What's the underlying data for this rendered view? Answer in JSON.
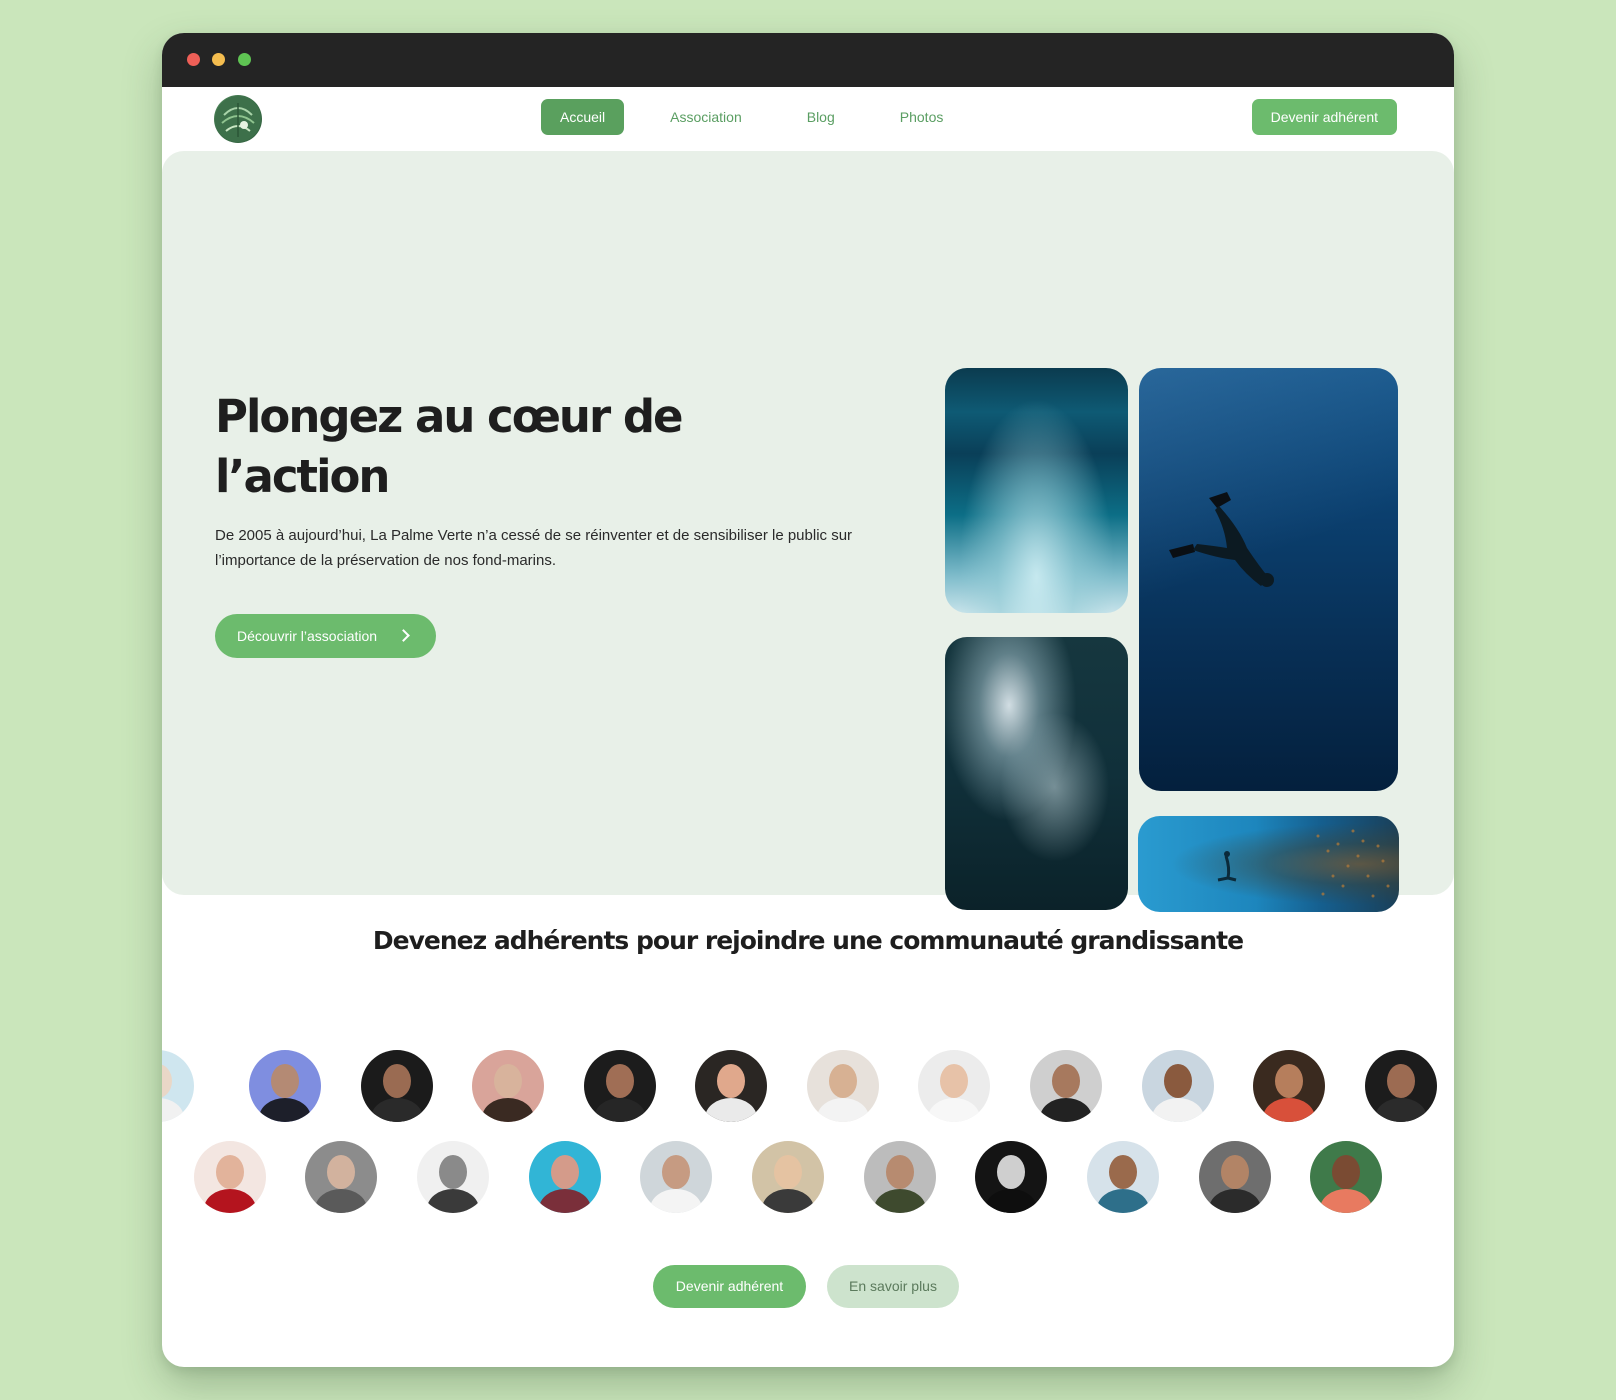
{
  "nav": {
    "items": [
      {
        "label": "Accueil",
        "active": true
      },
      {
        "label": "Association",
        "active": false
      },
      {
        "label": "Blog",
        "active": false
      },
      {
        "label": "Photos",
        "active": false
      }
    ],
    "cta_label": "Devenir adhérent"
  },
  "hero": {
    "title_line1": "Plongez au cœur de",
    "title_line2": "l’action",
    "description": "De 2005 à aujourd’hui, La Palme Verte n’a cessé de se réinventer et de sensibiliser le public sur l’importance de la préservation de nos fond-marins.",
    "button_label": "Découvrir l’association",
    "button_icon": "chevron-right-icon"
  },
  "community": {
    "title": "Devenez adhérents pour rejoindre une communauté grandissante",
    "primary_button": "Devenir adhérent",
    "secondary_button": "En savoir plus"
  },
  "colors": {
    "page_background": "#cae6bb",
    "accent_green": "#6cbb6d",
    "active_nav": "#5aa05e",
    "hero_background": "#e8f0e8",
    "secondary_button": "#cde3cd",
    "titlebar": "#242424"
  }
}
